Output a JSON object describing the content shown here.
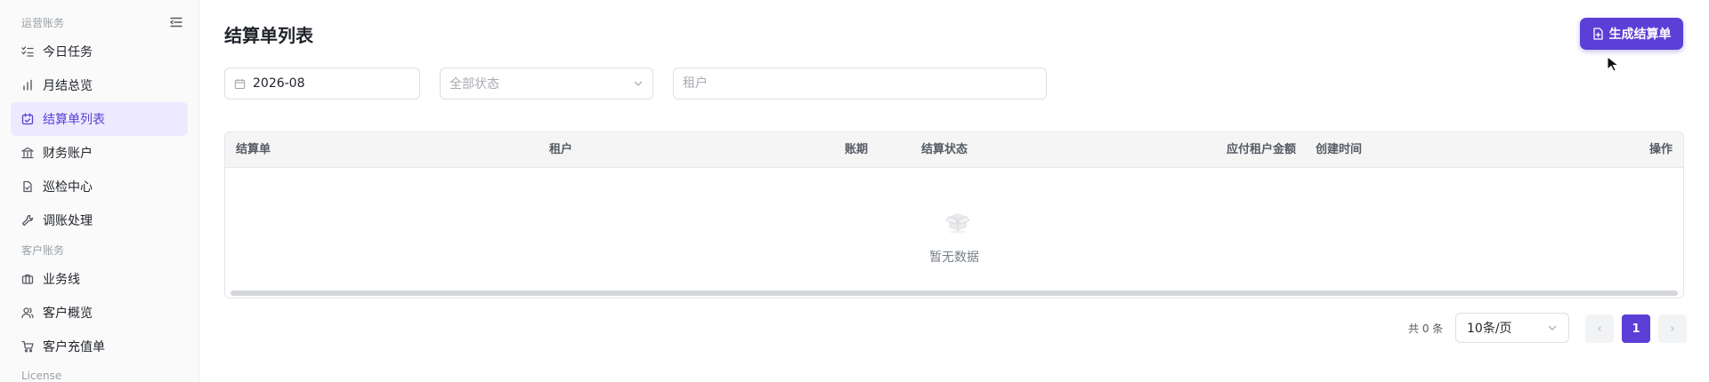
{
  "sidebar": {
    "groups": [
      {
        "label": "运营账务",
        "items": [
          {
            "label": "今日任务",
            "icon": "task-list-icon"
          },
          {
            "label": "月结总览",
            "icon": "bar-chart-icon"
          },
          {
            "label": "结算单列表",
            "icon": "calendar-check-icon",
            "active": true
          },
          {
            "label": "财务账户",
            "icon": "bank-icon"
          },
          {
            "label": "巡检中心",
            "icon": "file-check-icon"
          },
          {
            "label": "调账处理",
            "icon": "wrench-icon"
          }
        ]
      },
      {
        "label": "客户账务",
        "items": [
          {
            "label": "业务线",
            "icon": "briefcase-icon"
          },
          {
            "label": "客户概览",
            "icon": "users-icon"
          },
          {
            "label": "客户充值单",
            "icon": "cart-icon"
          }
        ]
      },
      {
        "label": "License",
        "items": []
      }
    ],
    "accent": "#5b3fd6",
    "active_bg": "#ede9fe"
  },
  "header": {
    "title": "结算单列表",
    "primary_button": "生成结算单"
  },
  "filters": {
    "month": "2026-08",
    "status_placeholder": "全部状态",
    "tenant_placeholder": "租户"
  },
  "table": {
    "columns": [
      "结算单",
      "租户",
      "账期",
      "结算状态",
      "应付租户金额",
      "创建时间",
      "操作"
    ],
    "rows": [],
    "empty_text": "暂无数据"
  },
  "pagination": {
    "total_text": "共 0 条",
    "page_size": "10条/页",
    "current_page": "1",
    "prev": "‹",
    "next": "›"
  }
}
